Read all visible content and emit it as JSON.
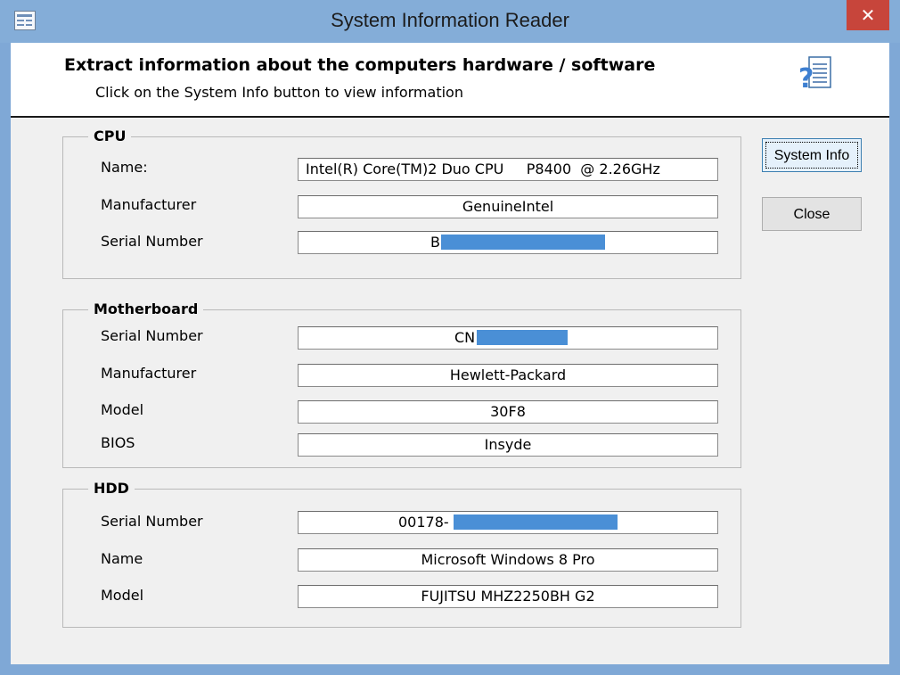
{
  "window": {
    "title": "System Information Reader",
    "close_glyph": "✕",
    "app_icon": "form-icon"
  },
  "header": {
    "title": "Extract information about the computers hardware / software",
    "subtitle": "Click on the System Info button to view information",
    "icon": "help-document-icon"
  },
  "cpu": {
    "legend": "CPU",
    "name_label": "Name:",
    "name_value": "Intel(R) Core(TM)2 Duo CPU     P8400  @ 2.26GHz",
    "manufacturer_label": "Manufacturer",
    "manufacturer_value": "GenuineIntel",
    "serial_label": "Serial Number",
    "serial_value": "B"
  },
  "motherboard": {
    "legend": "Motherboard",
    "serial_label": "Serial Number",
    "serial_value": "CN",
    "manufacturer_label": "Manufacturer",
    "manufacturer_value": "Hewlett-Packard",
    "model_label": "Model",
    "model_value": "30F8",
    "bios_label": "BIOS",
    "bios_value": "Insyde"
  },
  "hdd": {
    "legend": "HDD",
    "serial_label": "Serial Number",
    "serial_value": "00178-",
    "name_label": "Name",
    "name_value": "Microsoft Windows 8 Pro",
    "model_label": "Model",
    "model_value": "FUJITSU MHZ2250BH G2"
  },
  "buttons": {
    "system_info": "System Info",
    "close": "Close"
  },
  "colors": {
    "redaction": "#4a8fd6",
    "title_bar": "#84add8",
    "close_button": "#c7453b"
  }
}
